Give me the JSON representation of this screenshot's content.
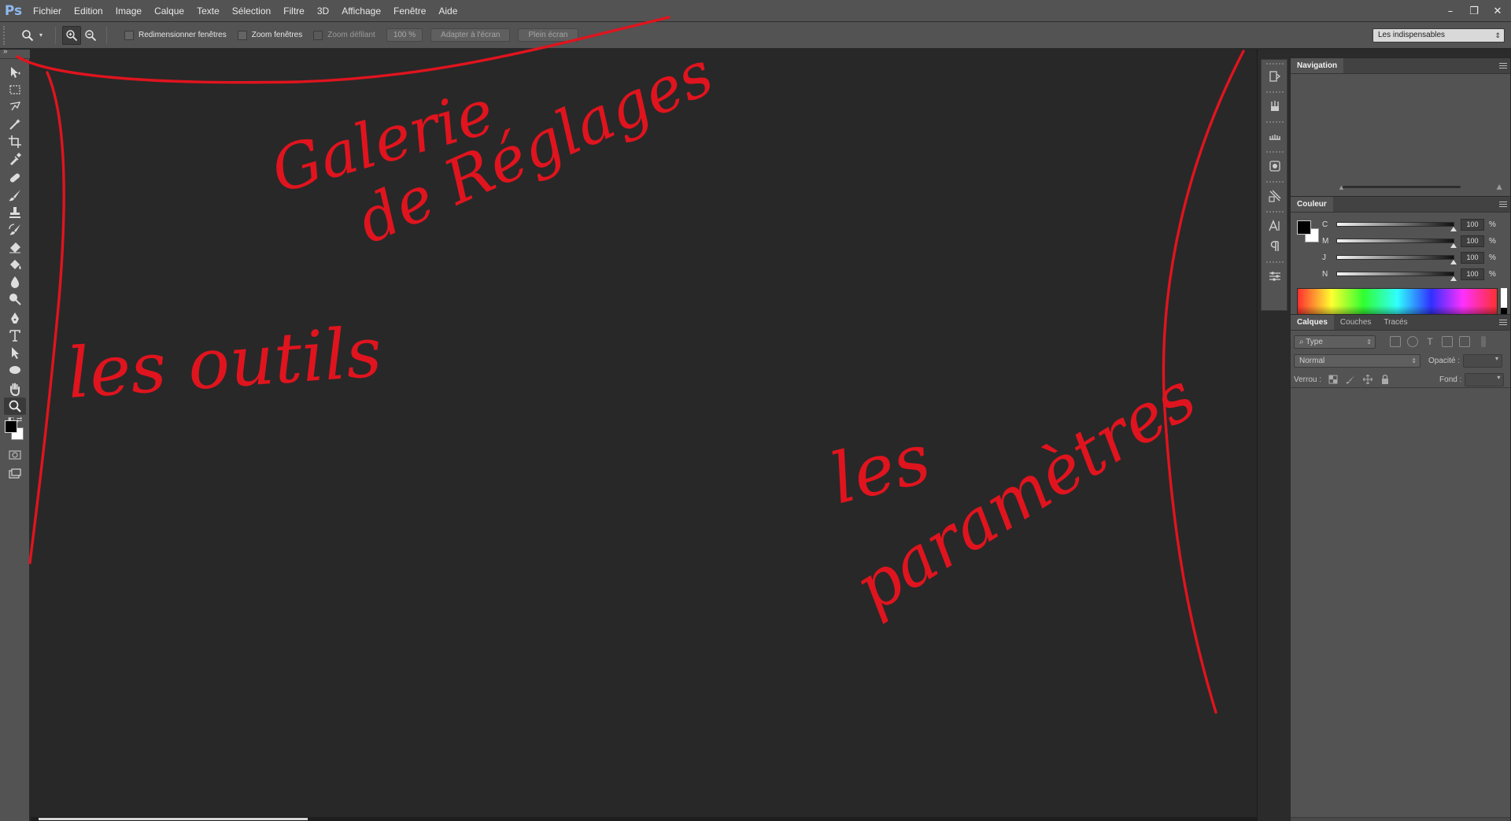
{
  "app": {
    "logo": "Ps",
    "menu": [
      "Fichier",
      "Edition",
      "Image",
      "Calque",
      "Texte",
      "Sélection",
      "Filtre",
      "3D",
      "Affichage",
      "Fenêtre",
      "Aide"
    ],
    "window_controls": [
      "–",
      "❐",
      "✕"
    ]
  },
  "options_bar": {
    "resize_windows": "Redimensionner fenêtres",
    "zoom_all_windows": "Zoom fenêtres",
    "scrubby_zoom": "Zoom défilant",
    "zoom_value": "100 %",
    "fit_screen": "Adapter à l'écran",
    "fill_screen": "Plein écran",
    "workspace": "Les indispensables"
  },
  "tools": [
    "move-tool-icon",
    "marquee-tool-icon",
    "lasso-tool-icon",
    "magic-wand-tool-icon",
    "crop-tool-icon",
    "eyedropper-tool-icon",
    "healing-brush-tool-icon",
    "brush-tool-icon",
    "clone-stamp-tool-icon",
    "history-brush-tool-icon",
    "eraser-tool-icon",
    "paint-bucket-tool-icon",
    "blur-tool-icon",
    "dodge-tool-icon",
    "pen-tool-icon",
    "type-tool-icon",
    "path-selection-tool-icon",
    "ellipse-tool-icon",
    "hand-tool-icon",
    "zoom-tool-icon"
  ],
  "annotations": {
    "gallery": [
      "Galerie",
      "de Réglages"
    ],
    "tools": "les outils",
    "params": [
      "les",
      "paramètres"
    ],
    "color": "#e0141e"
  },
  "panels": {
    "navigation": {
      "tab": "Navigation"
    },
    "color": {
      "tab": "Couleur",
      "channels": [
        {
          "label": "C",
          "value": "100",
          "unit": "%"
        },
        {
          "label": "M",
          "value": "100",
          "unit": "%"
        },
        {
          "label": "J",
          "value": "100",
          "unit": "%"
        },
        {
          "label": "N",
          "value": "100",
          "unit": "%"
        }
      ]
    },
    "layers": {
      "tabs": [
        "Calques",
        "Couches",
        "Tracés"
      ],
      "filter": "Type",
      "blend_mode": "Normal",
      "opacity_label": "Opacité :",
      "lock_label": "Verrou :",
      "fill_label": "Fond :"
    }
  }
}
